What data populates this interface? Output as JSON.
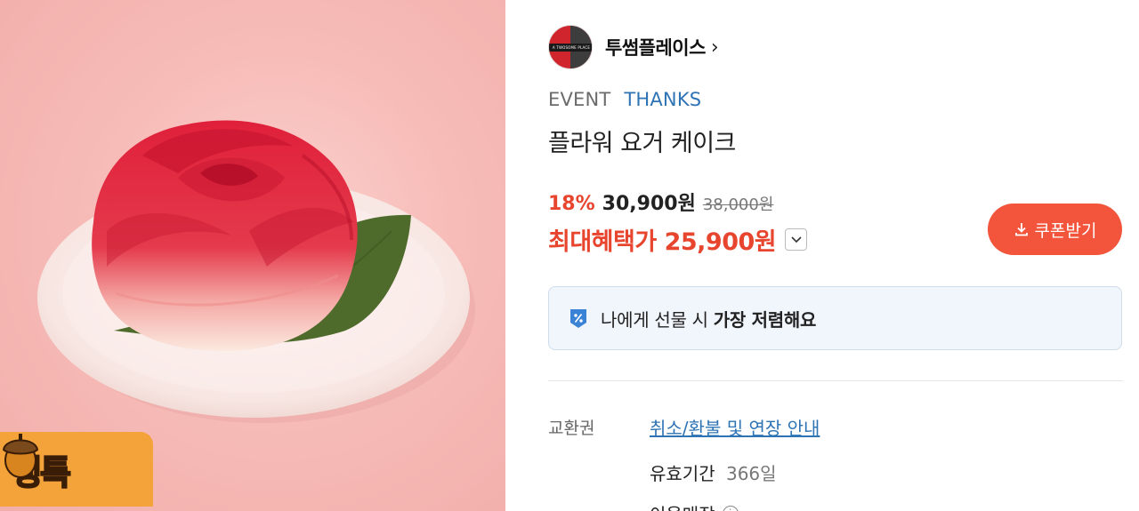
{
  "product_image": {
    "alt_icon": "rose-cake-image"
  },
  "badge": {
    "text": "쟁특",
    "icon": "acorn-icon"
  },
  "brand": {
    "name": "투썸플레이스",
    "logo_text": "A TWOSOME PLACE",
    "chevron": "›"
  },
  "tags": {
    "event": "EVENT",
    "thanks": "THANKS"
  },
  "product": {
    "title": "플라워 요거 케이크"
  },
  "pricing": {
    "discount": "18%",
    "price": "30,900원",
    "original_price": "38,000원",
    "max_benefit_label": "최대혜택가 25,900원"
  },
  "coupon": {
    "label": "쿠폰받기",
    "icon": "download-icon"
  },
  "gift_banner": {
    "text_prefix": "나에게 선물 시",
    "text_bold": "가장 저렴해요",
    "icon": "discount-tag-icon"
  },
  "info": {
    "label": "교환권",
    "link": "취소/환불 및 연장 안내",
    "validity_label": "유효기간",
    "validity_value": "366일",
    "usage_label": "이용매장"
  },
  "colors": {
    "accent_red": "#e8452f",
    "coupon_bg": "#f2553c",
    "link_blue": "#2e74b5",
    "gift_bg": "#f1f6fd"
  }
}
